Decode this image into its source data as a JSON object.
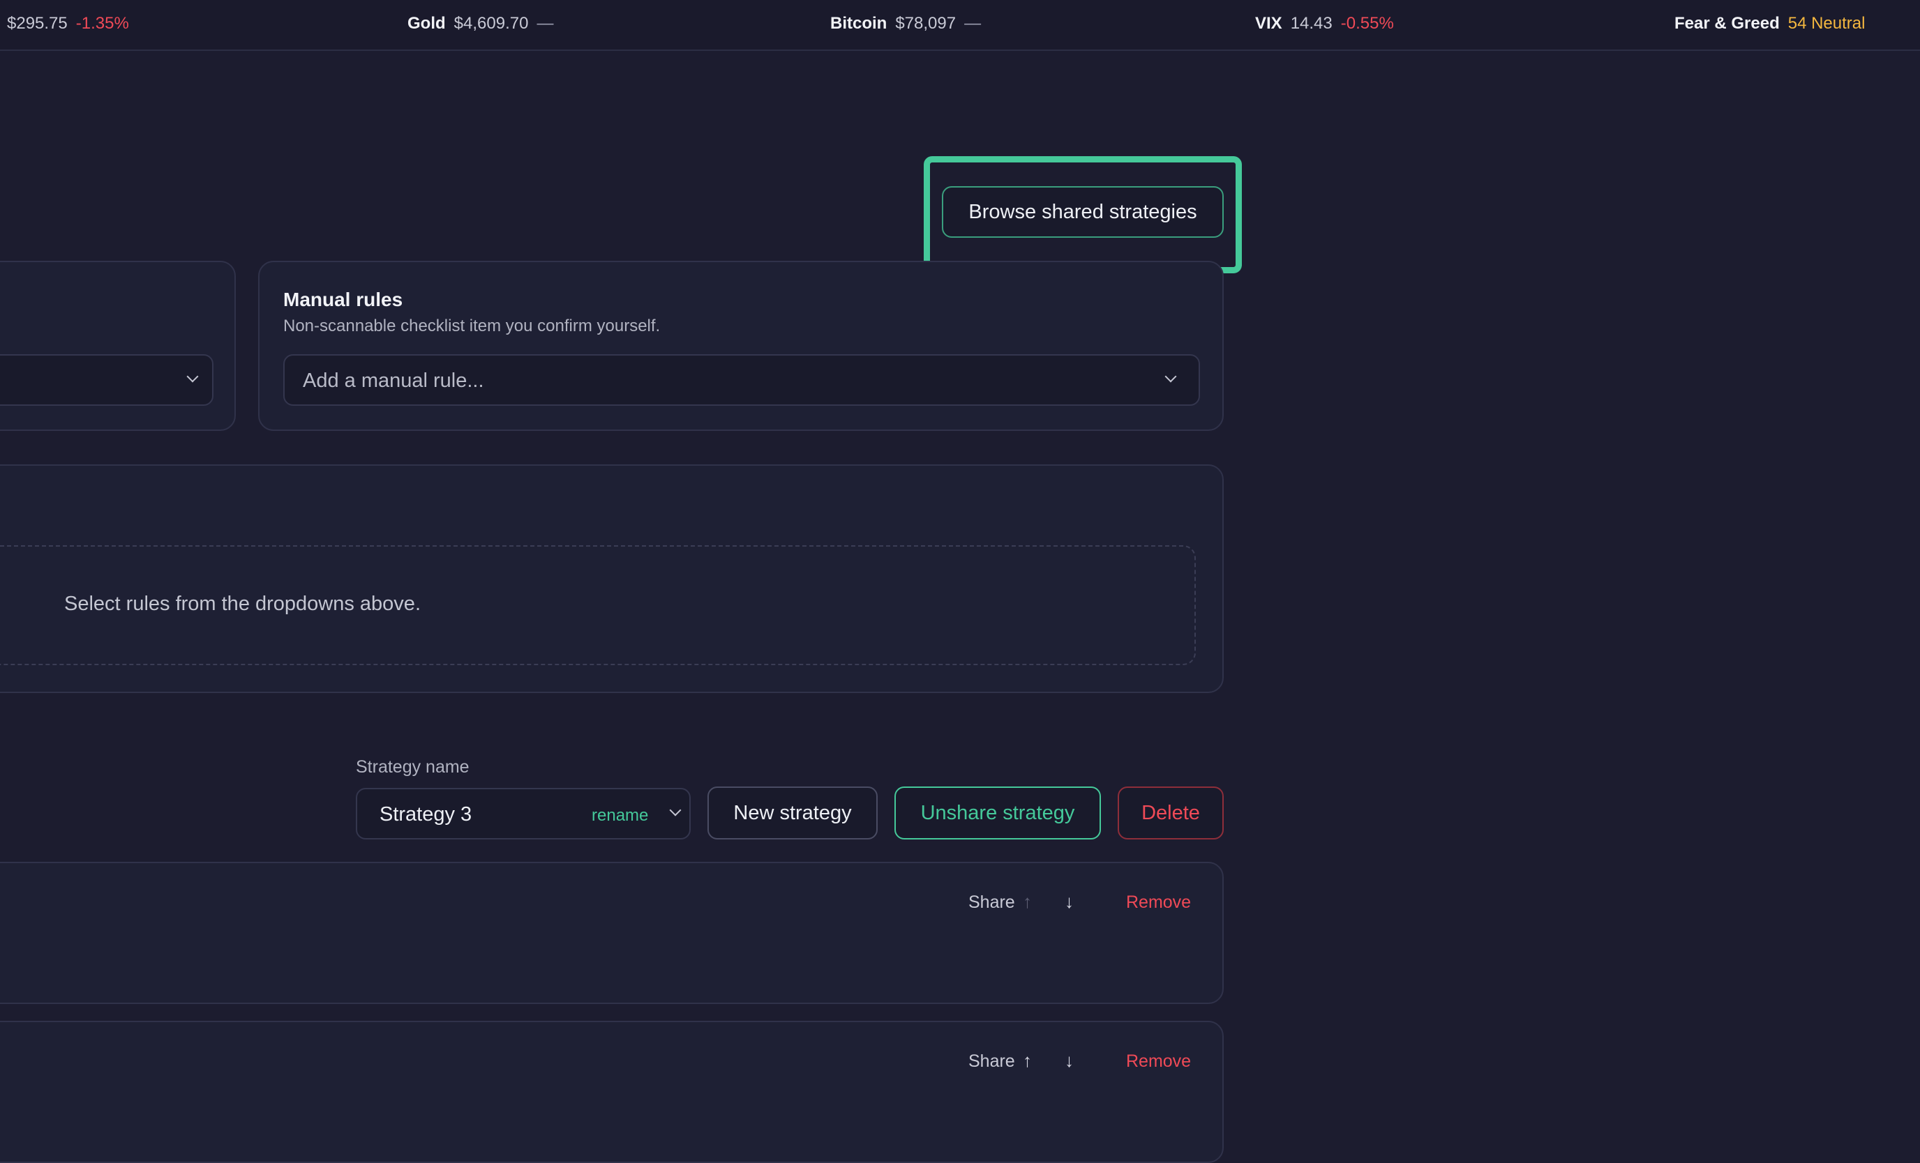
{
  "ticker": [
    {
      "symbol": "",
      "price": "$295.75",
      "change": "-1.35%",
      "tone": "neg"
    },
    {
      "symbol": "Gold",
      "price": "$4,609.70",
      "change": "—",
      "tone": "flat"
    },
    {
      "symbol": "Bitcoin",
      "price": "$78,097",
      "change": "—",
      "tone": "flat"
    },
    {
      "symbol": "VIX",
      "price": "14.43",
      "change": "-0.55%",
      "tone": "neg"
    },
    {
      "symbol": "Fear & Greed",
      "price": "",
      "change": "54 Neutral",
      "tone": "warn"
    }
  ],
  "browse_button": "Browse shared strategies",
  "manual_rules": {
    "title": "Manual rules",
    "subtitle": "Non-scannable checklist item you confirm yourself.",
    "placeholder": "Add a manual rule..."
  },
  "rules_empty": "Select rules from the dropdowns above.",
  "strategy": {
    "label": "Strategy name",
    "name": "Strategy 3",
    "rename": "rename",
    "new_button": "New strategy",
    "unshare_button": "Unshare strategy",
    "delete_button": "Delete"
  },
  "rows": [
    {
      "share": "Share",
      "up": "↑",
      "down": "↓",
      "remove": "Remove"
    },
    {
      "share": "Share",
      "up": "↑",
      "down": "↓",
      "remove": "Remove"
    }
  ],
  "colors": {
    "accent": "#45c99a",
    "negative": "#ef4a57",
    "warning": "#f4b73f",
    "background": "#1c1c2f"
  }
}
